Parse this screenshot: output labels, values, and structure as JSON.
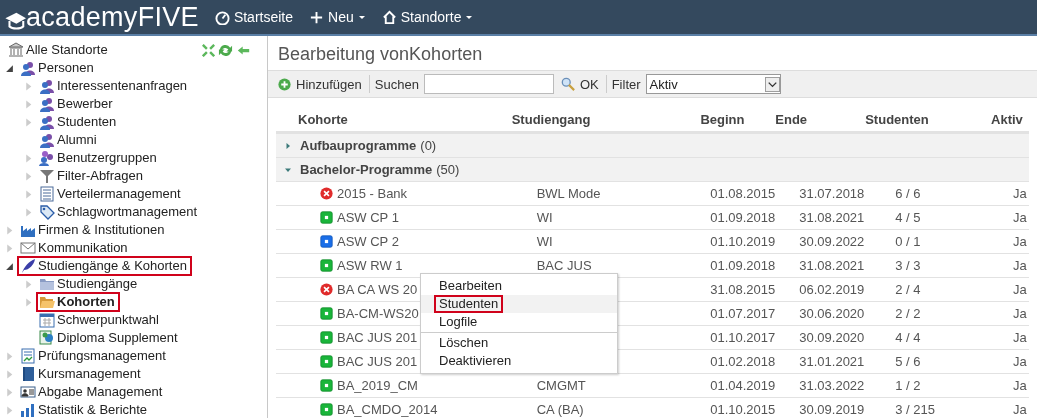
{
  "header": {
    "logo": "academyFIVE",
    "nav": [
      {
        "kind": "gauge",
        "label": "Startseite",
        "dropdown": false
      },
      {
        "kind": "plus",
        "label": "Neu",
        "dropdown": true
      },
      {
        "kind": "home",
        "label": "Standorte",
        "dropdown": true
      }
    ]
  },
  "sidebar": {
    "items": [
      {
        "kind": "bank",
        "label": "Alle Standorte",
        "selected": false,
        "highlighted": false
      },
      {
        "kind": "people",
        "label": "Personen",
        "expanded": true,
        "selected": false,
        "highlighted": false,
        "children": [
          {
            "kind": "people",
            "label": "Interessentenanfragen",
            "expanded": false,
            "selected": false,
            "highlighted": false
          },
          {
            "kind": "people",
            "label": "Bewerber",
            "expanded": false,
            "selected": false,
            "highlighted": false
          },
          {
            "kind": "people",
            "label": "Studenten",
            "expanded": false,
            "selected": false,
            "highlighted": false
          },
          {
            "kind": "people",
            "label": "Alumni",
            "selected": false,
            "highlighted": false
          },
          {
            "kind": "group",
            "label": "Benutzergruppen",
            "expanded": false,
            "selected": false,
            "highlighted": false
          },
          {
            "kind": "filter",
            "label": "Filter-Abfragen",
            "expanded": false,
            "selected": false,
            "highlighted": false
          },
          {
            "kind": "list",
            "label": "Verteilermanagement",
            "expanded": false,
            "selected": false,
            "highlighted": false
          },
          {
            "kind": "tag",
            "label": "Schlagwortmanagement",
            "expanded": false,
            "selected": false,
            "highlighted": false
          }
        ]
      },
      {
        "kind": "factory",
        "label": "Firmen & Institutionen",
        "expanded": false,
        "selected": false,
        "highlighted": false
      },
      {
        "kind": "mail",
        "label": "Kommunikation",
        "expanded": false,
        "selected": false,
        "highlighted": false
      },
      {
        "kind": "feather",
        "label": "Studiengänge & Kohorten",
        "expanded": true,
        "selected": false,
        "highlighted": true,
        "children": [
          {
            "kind": "folder",
            "label": "Studiengänge",
            "expanded": false,
            "selected": false,
            "highlighted": false
          },
          {
            "kind": "folder-open",
            "label": "Kohorten",
            "expanded": false,
            "selected": true,
            "highlighted": true
          },
          {
            "kind": "calendar",
            "label": "Schwerpunktwahl",
            "selected": false,
            "highlighted": false
          },
          {
            "kind": "certificate",
            "label": "Diploma Supplement",
            "selected": false,
            "highlighted": false
          }
        ]
      },
      {
        "kind": "report",
        "label": "Prüfungsmanagement",
        "expanded": false,
        "selected": false,
        "highlighted": false
      },
      {
        "kind": "book",
        "label": "Kursmanagement",
        "expanded": false,
        "selected": false,
        "highlighted": false
      },
      {
        "kind": "idcard",
        "label": "Abgabe Management",
        "expanded": false,
        "selected": false,
        "highlighted": false
      },
      {
        "kind": "chart",
        "label": "Statistik & Berichte",
        "expanded": false,
        "selected": false,
        "highlighted": false
      }
    ]
  },
  "main": {
    "title": "Bearbeitung vonKohorten",
    "toolbar": {
      "add": "Hinzufügen",
      "search_label": "Suchen",
      "ok": "OK",
      "filter_label": "Filter",
      "filter_value": "Aktiv"
    },
    "table": {
      "columns": [
        "Kohorte",
        "Studiengang",
        "Beginn",
        "Ende",
        "Studenten",
        "Aktiv"
      ],
      "groups": [
        {
          "name": "Aufbauprogramme",
          "count": "(0)",
          "expanded": false
        },
        {
          "name": "Bachelor-Programme",
          "count": "(50)",
          "expanded": true,
          "rows": [
            {
              "kind": "error",
              "kohorte": "2015 - Bank",
              "studiengang": "BWL Mode",
              "beginn": "01.08.2015",
              "ende": "31.07.2018",
              "studenten": "6 / 6",
              "aktiv": "Ja"
            },
            {
              "kind": "active",
              "kohorte": "ASW CP 1",
              "studiengang": "WI",
              "beginn": "01.09.2018",
              "ende": "31.08.2021",
              "studenten": "4 / 5",
              "aktiv": "Ja"
            },
            {
              "kind": "planned",
              "kohorte": "ASW CP 2",
              "studiengang": "WI",
              "beginn": "01.10.2019",
              "ende": "30.09.2022",
              "studenten": "0 / 1",
              "aktiv": "Ja"
            },
            {
              "kind": "active",
              "kohorte": "ASW RW 1",
              "studiengang": "BAC JUS",
              "beginn": "01.09.2018",
              "ende": "31.08.2021",
              "studenten": "3 / 3",
              "aktiv": "Ja"
            },
            {
              "kind": "error",
              "kohorte": "BA CA WS 20",
              "beginn": "31.08.2015",
              "ende": "06.02.2019",
              "studenten": "2 / 4",
              "aktiv": "Ja"
            },
            {
              "kind": "active",
              "kohorte": "BA-CM-WS20",
              "beginn": "01.07.2017",
              "ende": "30.06.2020",
              "studenten": "2 / 2",
              "aktiv": "Ja"
            },
            {
              "kind": "active",
              "kohorte": "BAC JUS 201",
              "beginn": "01.10.2017",
              "ende": "30.09.2020",
              "studenten": "4 / 4",
              "aktiv": "Ja"
            },
            {
              "kind": "active",
              "kohorte": "BAC JUS 201",
              "beginn": "01.02.2018",
              "ende": "31.01.2021",
              "studenten": "5 / 6",
              "aktiv": "Ja"
            },
            {
              "kind": "active",
              "kohorte": "BA_2019_CM",
              "studiengang": "CMGMT",
              "beginn": "01.04.2019",
              "ende": "31.03.2022",
              "studenten": "1 / 2",
              "aktiv": "Ja"
            },
            {
              "kind": "active",
              "kohorte": "BA_CMDO_2014",
              "studiengang": "CA (BA)",
              "beginn": "01.10.2015",
              "ende": "30.09.2019",
              "studenten": "3 / 215",
              "aktiv": "Ja"
            }
          ]
        }
      ]
    },
    "context_menu": [
      {
        "label": "Bearbeiten",
        "hovered": false,
        "highlighted": false,
        "divider_before": false
      },
      {
        "label": "Studenten",
        "hovered": true,
        "highlighted": true,
        "divider_before": false
      },
      {
        "label": "Logfile",
        "hovered": false,
        "highlighted": false,
        "divider_before": false
      },
      {
        "label": "Löschen",
        "hovered": false,
        "highlighted": false,
        "divider_before": true
      },
      {
        "label": "Deaktivieren",
        "hovered": false,
        "highlighted": false,
        "divider_before": false
      }
    ]
  }
}
